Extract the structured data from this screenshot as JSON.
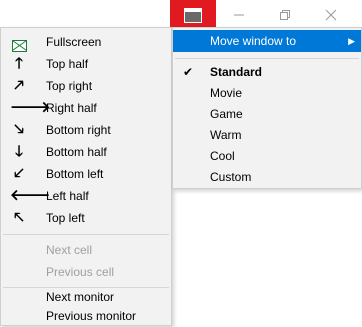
{
  "window_controls": {
    "app_icon": "monitor-icon",
    "minimize_icon": "minimize-icon",
    "maximize_icon": "maximize-icon",
    "close_icon": "close-icon",
    "accent_color": "#e11a22"
  },
  "menu": {
    "items": [
      {
        "label": "Fullscreen",
        "icon": "fullscreen-icon",
        "glyph": ""
      },
      {
        "label": "Top half",
        "icon": "arrow-up-icon",
        "glyph": "🡑"
      },
      {
        "label": "Top right",
        "icon": "arrow-up-right-icon",
        "glyph": "🡕"
      },
      {
        "label": "Right half",
        "icon": "arrow-right-icon",
        "glyph": "🡒"
      },
      {
        "label": "Bottom right",
        "icon": "arrow-down-right-icon",
        "glyph": "🡖"
      },
      {
        "label": "Bottom half",
        "icon": "arrow-down-icon",
        "glyph": "🡓"
      },
      {
        "label": "Bottom left",
        "icon": "arrow-down-left-icon",
        "glyph": "🡗"
      },
      {
        "label": "Left half",
        "icon": "arrow-left-icon",
        "glyph": "🡐"
      },
      {
        "label": "Top left",
        "icon": "arrow-up-left-icon",
        "glyph": "🡔"
      }
    ],
    "cell_items": [
      {
        "label": "Next cell",
        "disabled": true
      },
      {
        "label": "Previous cell",
        "disabled": true
      }
    ],
    "monitor_items": [
      {
        "label": "Next monitor"
      },
      {
        "label": "Previous monitor"
      }
    ]
  },
  "submenu": {
    "header": "Move window to",
    "highlight_color": "#0078d7",
    "items": [
      {
        "label": "Standard",
        "checked": true
      },
      {
        "label": "Movie",
        "checked": false
      },
      {
        "label": "Game",
        "checked": false
      },
      {
        "label": "Warm",
        "checked": false
      },
      {
        "label": "Cool",
        "checked": false
      },
      {
        "label": "Custom",
        "checked": false
      }
    ]
  }
}
